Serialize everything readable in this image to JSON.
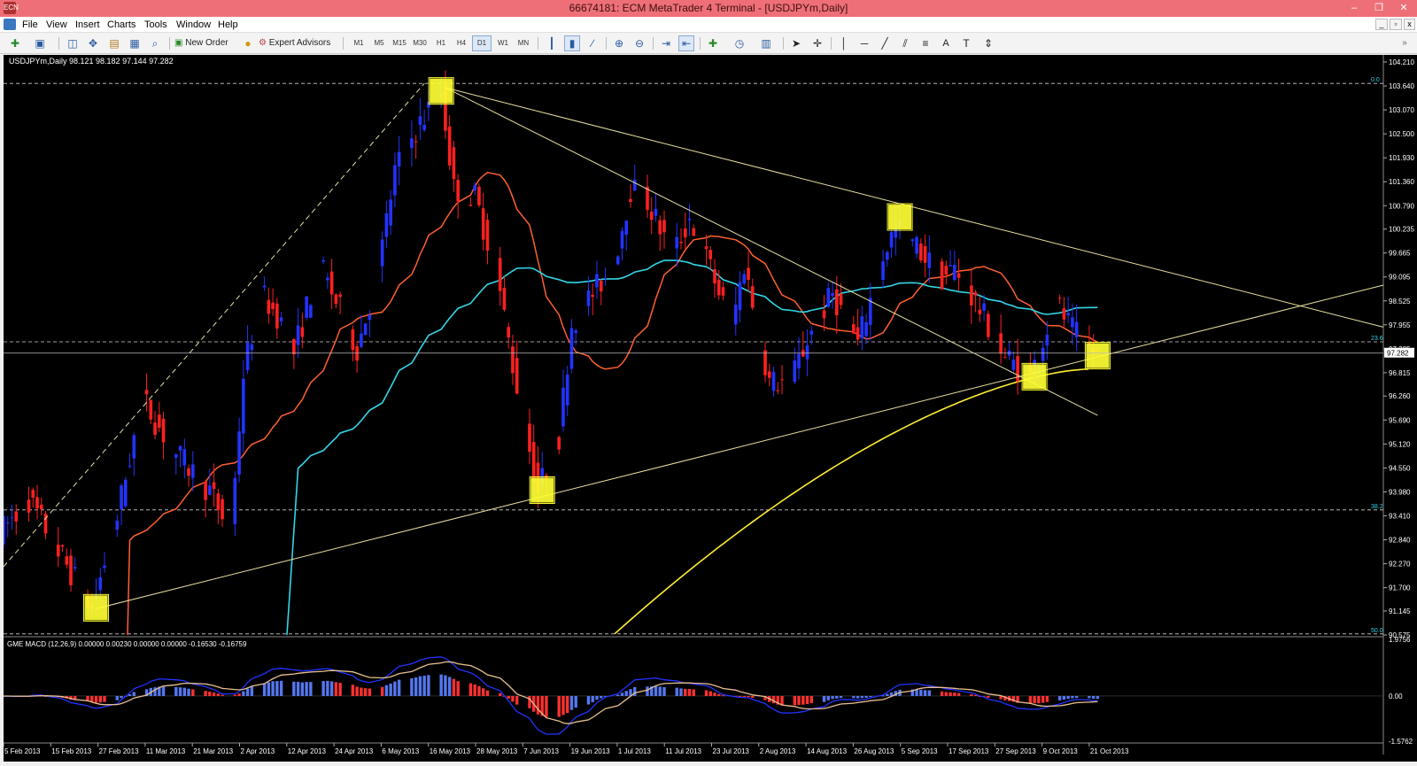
{
  "window": {
    "title": "66674181: ECM MetaTrader 4 Terminal - [USDJPYm,Daily]",
    "logo_icon": "mt4-logo-icon",
    "minimize_glyph": "–",
    "restore_glyph": "❐",
    "close_glyph": "✕"
  },
  "menu": {
    "items": [
      "File",
      "View",
      "Insert",
      "Charts",
      "Tools",
      "Window",
      "Help"
    ],
    "mdi_minimize": "_",
    "mdi_restore": "▫",
    "mdi_close": "x"
  },
  "toolbar": {
    "new_order_label": "New Order",
    "expert_advisors_label": "Expert Advisors",
    "timeframes": [
      "M1",
      "M5",
      "M15",
      "M30",
      "H1",
      "H4",
      "D1",
      "W1",
      "MN"
    ],
    "active_timeframe": "D1",
    "icons": [
      "new-chart-icon",
      "profiles-icon",
      "market-watch-icon",
      "navigator-icon",
      "terminal-icon",
      "strategy-tester-icon",
      "new-order-icon",
      "expert-advisors-icon",
      "bar-chart-icon",
      "candlesticks-icon",
      "line-chart-icon",
      "zoom-in-icon",
      "zoom-out-icon",
      "autoscroll-icon",
      "chart-shift-icon",
      "indicators-icon",
      "periods-icon",
      "templates-icon",
      "cursor-icon",
      "crosshair-icon",
      "vertical-line-icon",
      "horizontal-line-icon",
      "trendline-icon",
      "equidistant-channel-icon",
      "fibonacci-icon",
      "text-icon",
      "text-label-icon",
      "arrows-icon"
    ]
  },
  "chart_data": {
    "type": "candlestick",
    "symbol_header": "USDJPYm,Daily  98.121 98.182 97.144 97.282",
    "current_price": "97.282",
    "price_axis_ticks": [
      "104.210",
      "103.640",
      "103.070",
      "102.500",
      "101.930",
      "101.360",
      "100.790",
      "100.235",
      "99.665",
      "99.095",
      "98.525",
      "97.955",
      "97.385",
      "96.815",
      "96.260",
      "95.690",
      "95.120",
      "94.550",
      "93.980",
      "93.410",
      "92.840",
      "92.270",
      "91.700",
      "91.145",
      "90.575"
    ],
    "ylim": [
      90.575,
      104.21
    ],
    "date_labels": [
      "5 Feb 2013",
      "15 Feb 2013",
      "27 Feb 2013",
      "11 Mar 2013",
      "21 Mar 2013",
      "2 Apr 2013",
      "12 Apr 2013",
      "24 Apr 2013",
      "6 May 2013",
      "16 May 2013",
      "28 May 2013",
      "7 Jun 2013",
      "19 Jun 2013",
      "1 Jul 2013",
      "11 Jul 2013",
      "23 Jul 2013",
      "2 Aug 2013",
      "14 Aug 2013",
      "26 Aug 2013",
      "5 Sep 2013",
      "17 Sep 2013",
      "27 Sep 2013",
      "9 Oct 2013",
      "21 Oct 2013"
    ],
    "fibonacci_levels": [
      {
        "label": "0.0",
        "price": 103.7
      },
      {
        "label": "23.6",
        "price": 97.55
      },
      {
        "label": "38.2",
        "price": 93.55
      },
      {
        "label": "50.0",
        "price": 90.6
      }
    ],
    "swing_points": [
      {
        "date": "27 Feb 2013",
        "price": 91.2
      },
      {
        "date": "20 May 2013",
        "price": 103.5
      },
      {
        "date": "13 Jun 2013",
        "price": 94.0
      },
      {
        "date": "6 Sep 2013",
        "price": 100.5
      },
      {
        "date": "8 Oct 2013",
        "price": 96.7
      },
      {
        "date": "23 Oct 2013",
        "price": 97.2
      }
    ],
    "macd": {
      "header": "GME MACD (12,26,9) 0.00000 0.00230 0.00000 0.00000 -0.16530 -0.16759",
      "ticks": [
        "1.9756",
        "0.00",
        "-1.5762"
      ],
      "ylim": [
        -1.5762,
        1.9756
      ]
    },
    "colors": {
      "bull": "#2233ff",
      "bear": "#ff2020",
      "ma_fast": "#ff6030",
      "ma_mid": "#33d6e8",
      "ma_slow": "#ffee33",
      "trendline": "#e8e0a0",
      "marker": "#ffff33",
      "macd_line": "#2233ff",
      "signal_line": "#e8c090"
    }
  }
}
